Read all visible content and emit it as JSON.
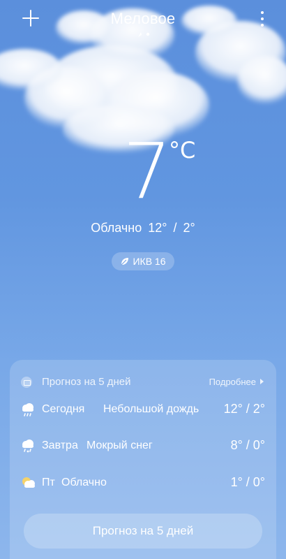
{
  "header": {
    "city": "Меловое"
  },
  "current": {
    "temperature": "7",
    "unit": "°C",
    "condition": "Облачно",
    "range": "12° / 2°",
    "aqi_label": "ИКВ 16"
  },
  "forecast": {
    "title": "Прогноз на 5 дней",
    "more_label": "Подробнее",
    "days": [
      {
        "day": "Сегодня",
        "condition": "Небольшой дождь",
        "range": "12° / 2°",
        "icon": "light-rain-icon"
      },
      {
        "day": "Завтра",
        "condition": "Мокрый снег",
        "range": "8° / 0°",
        "icon": "sleet-icon"
      },
      {
        "day": "Пт",
        "condition": "Облачно",
        "range": "1° / 0°",
        "icon": "partly-cloudy-icon"
      }
    ],
    "button_label": "Прогноз на 5 дней"
  },
  "colors": {
    "sky_top": "#5b8fdc",
    "sky_bottom": "#8db6ec",
    "text": "#ffffff"
  }
}
